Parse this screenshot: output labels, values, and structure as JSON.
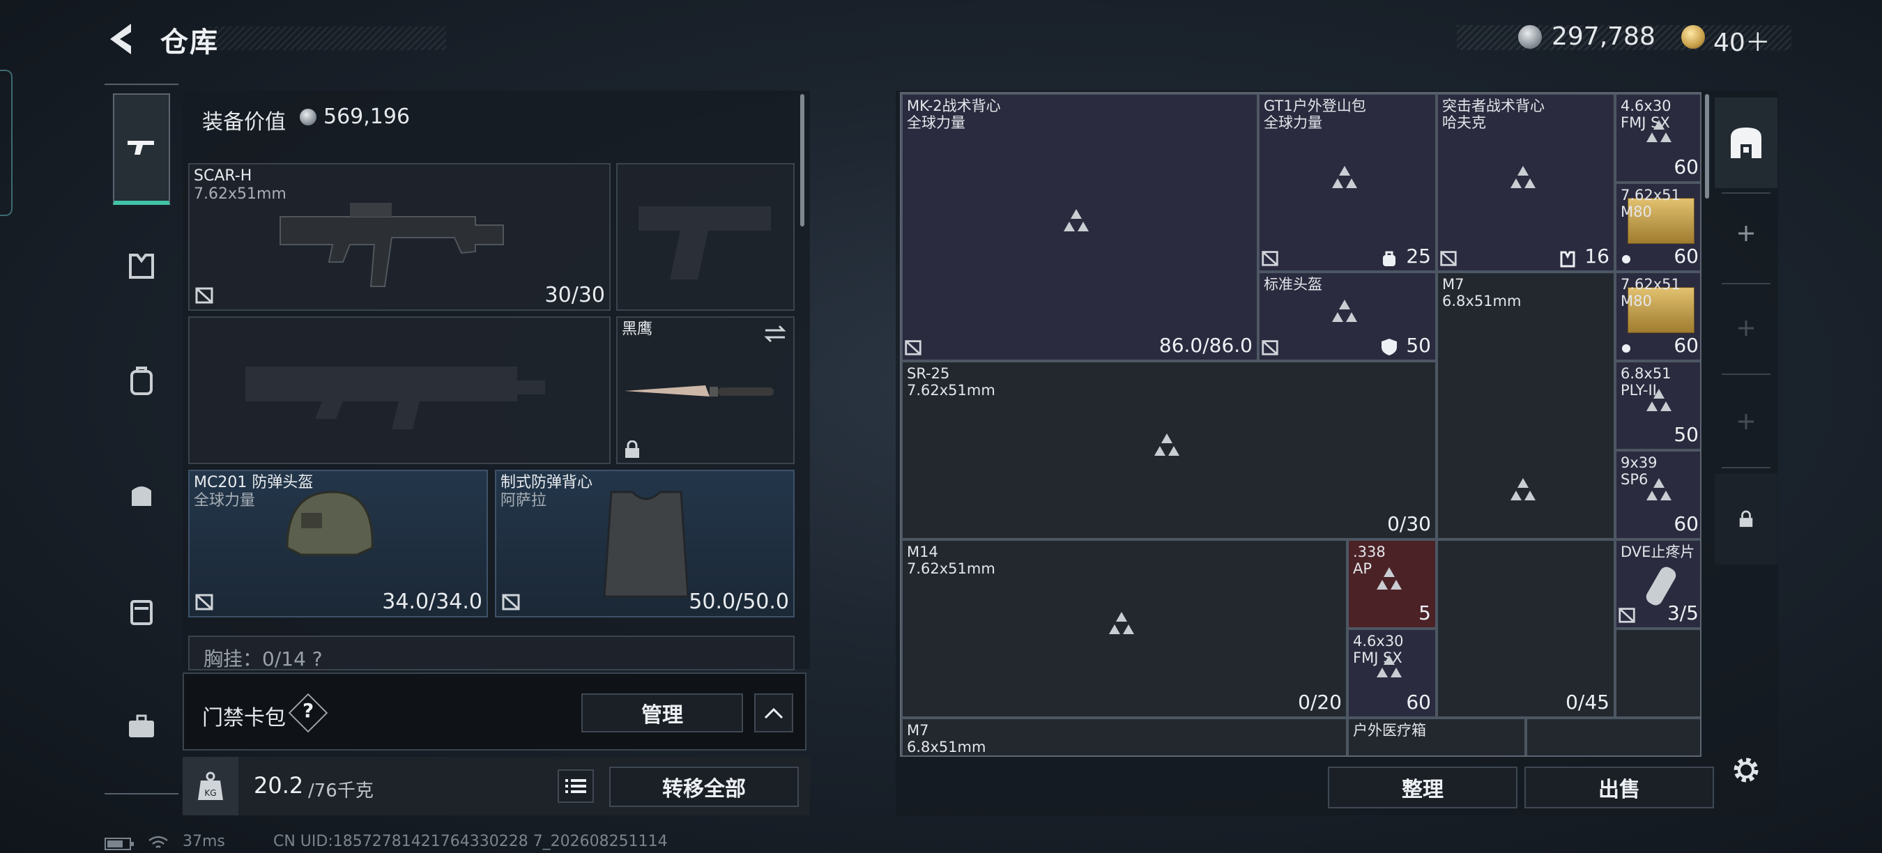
{
  "header": {
    "title": "仓库",
    "currency1": "297,788",
    "currency2": "40＋"
  },
  "loadout": {
    "equip_label": "装备价值",
    "equip_value": "569,196",
    "primary": {
      "name": "SCAR-H",
      "sub": "7.62x51mm",
      "ammo": "30/30"
    },
    "melee": {
      "name": "黑鹰"
    },
    "helmet": {
      "name": "MC201 防弹头盔",
      "sub": "全球力量",
      "durability": "34.0/34.0"
    },
    "vest": {
      "name": "制式防弹背心",
      "sub": "阿萨拉",
      "durability": "50.0/50.0"
    },
    "chest_rig": "胸挂：0/14  ?",
    "keycard": {
      "label": "门禁卡包",
      "help": "?",
      "manage": "管理"
    },
    "weight": {
      "current": "20.2",
      "max": "/76千克"
    },
    "transfer_all": "转移全部"
  },
  "grid": {
    "items": [
      {
        "name": "MK-2战术背心",
        "sub": "全球力量",
        "value": "86.0/86.0"
      },
      {
        "name": "GT1户外登山包",
        "sub": "全球力量",
        "value": "25"
      },
      {
        "name": "突击者战术背心",
        "sub": "哈夫克",
        "value": "16"
      },
      {
        "name": "4.6x30",
        "sub": "FMJ SX",
        "value": "60"
      },
      {
        "name": "7.62x51",
        "sub": "M80",
        "value": "60"
      },
      {
        "name": "标准头盔",
        "value": "50"
      },
      {
        "name": "M7",
        "sub": "6.8x51mm"
      },
      {
        "name": "7.62x51",
        "sub": "M80",
        "value": "60"
      },
      {
        "name": "SR-25",
        "sub": "7.62x51mm",
        "value": "0/30"
      },
      {
        "name": "6.8x51",
        "sub": "PLY-II",
        "value": "50"
      },
      {
        "name": "9x39",
        "sub": "SP6",
        "value": "60"
      },
      {
        "name": "M14",
        "sub": "7.62x51mm",
        "value": "0/20"
      },
      {
        "name": ".338",
        "sub": "AP",
        "value": "5"
      },
      {
        "name": "DVE止疼片",
        "value": "3/5"
      },
      {
        "name": "4.6x30",
        "sub": "FMJ SX",
        "value": "60"
      },
      {
        "value": "0/45"
      },
      {
        "name": "M7",
        "sub": "6.8x51mm"
      },
      {
        "name": "户外医疗箱"
      }
    ],
    "sort_button": "整理",
    "sell_button": "出售"
  },
  "status": {
    "ping": "37ms",
    "uid": "CN UID:18572781421764330228 7_202608251114"
  },
  "colors": {
    "accent": "#42c3a8",
    "item_purple": "#2b2b3f",
    "item_red": "#4b2226"
  },
  "icons": [
    "back-arrow-icon",
    "silver-coin-icon",
    "gold-token-icon",
    "weapon-nav-icon",
    "armor-nav-icon",
    "backpack-nav-icon",
    "rig-nav-icon",
    "case-nav-icon",
    "toolbox-nav-icon",
    "no-protection-icon",
    "lock-icon",
    "swap-icon",
    "weight-icon",
    "list-icon",
    "warehouse-icon",
    "plus-icon",
    "settings-gear-icon",
    "battery-icon",
    "wifi-icon"
  ]
}
